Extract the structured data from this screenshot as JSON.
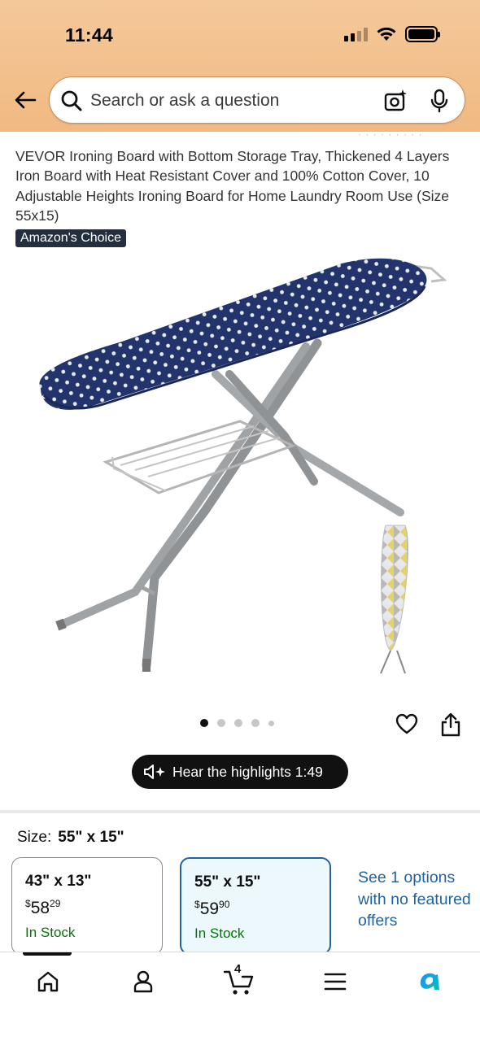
{
  "status_bar": {
    "time": "11:44"
  },
  "search": {
    "placeholder": "Search or ask a question"
  },
  "product": {
    "title": "VEVOR Ironing Board with Bottom Storage Tray, Thickened 4 Layers Iron Board with Heat Resistant Cover and 100% Cotton Cover, 10 Adjustable Heights Ironing Board for Home Laundry Room Use (Size 55x15)",
    "badge": "Amazon's Choice",
    "image_icon": "ironing-board-image",
    "carousel": {
      "count": 5,
      "active_index": 0
    }
  },
  "audio": {
    "label": "Hear the highlights 1:49"
  },
  "size": {
    "label": "Size:",
    "selected": "55\" x 15\"",
    "options": [
      {
        "dim": "43\" x 13\"",
        "currency": "$",
        "whole": "58",
        "fraction": "29",
        "stock": "In Stock"
      },
      {
        "dim": "55\" x 15\"",
        "currency": "$",
        "whole": "59",
        "fraction": "90",
        "stock": "In Stock"
      }
    ],
    "see_more": "See 1 options with no featured offers"
  },
  "nav": {
    "cart_count": "4",
    "items": [
      "home-icon",
      "account-icon",
      "cart-icon",
      "menu-icon",
      "rufus-icon"
    ]
  },
  "colors": {
    "header": "#f0b982",
    "link": "#2162a1",
    "stock": "#007600",
    "badge": "#232f3e",
    "board_cover": "#22346b"
  }
}
